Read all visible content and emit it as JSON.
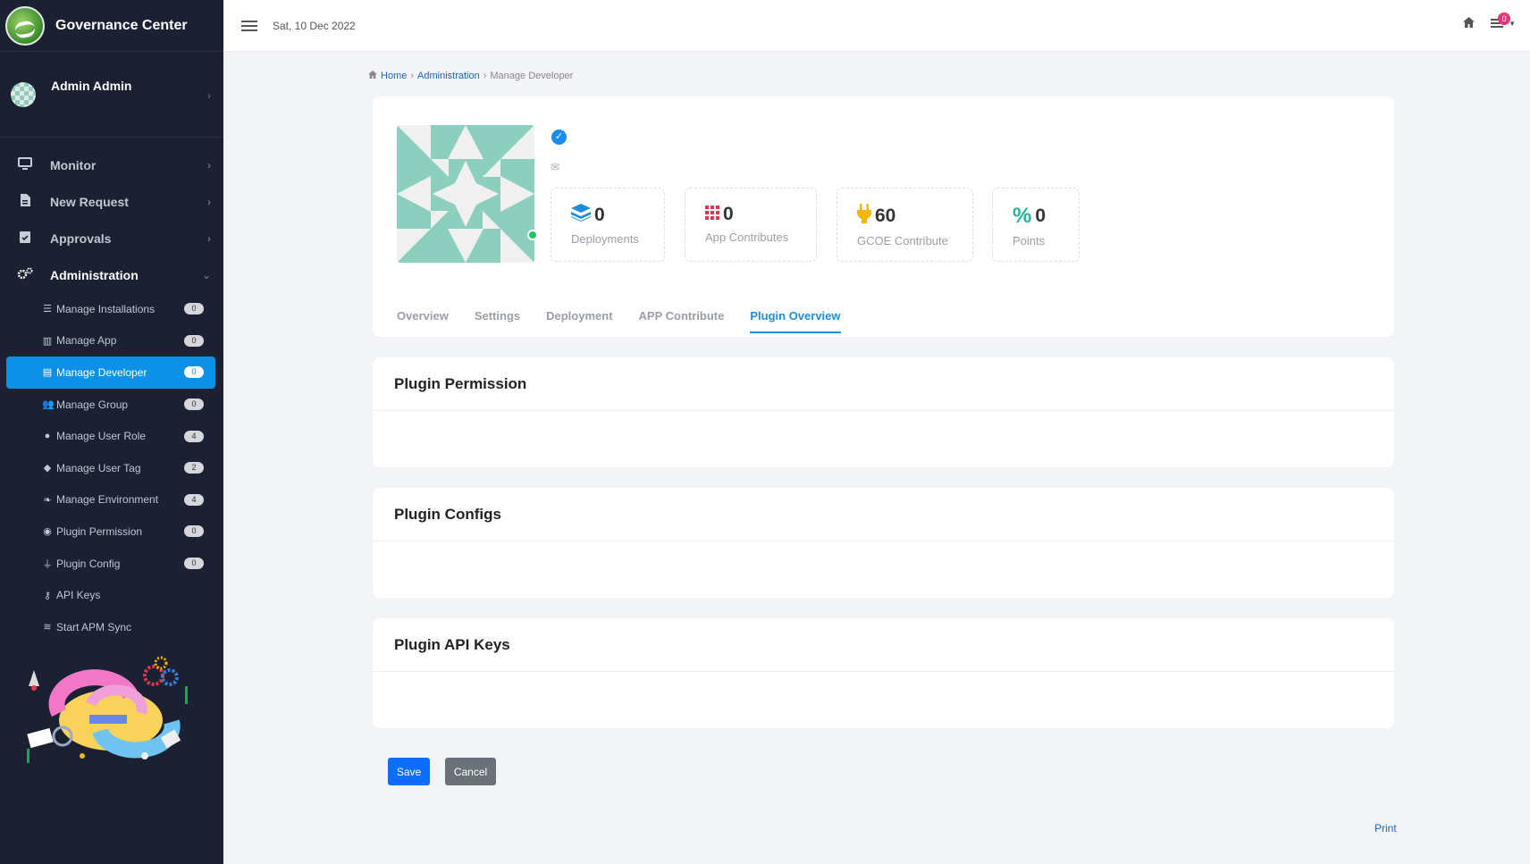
{
  "brand": {
    "name": "Governance Center"
  },
  "user": {
    "name": "Admin Admin"
  },
  "nav": {
    "items": [
      {
        "label": "Monitor",
        "icon": "monitor-icon"
      },
      {
        "label": "New Request",
        "icon": "file-icon"
      },
      {
        "label": "Approvals",
        "icon": "clipboard-check-icon"
      },
      {
        "label": "Administration",
        "icon": "cogs-icon"
      }
    ],
    "sub_items": [
      {
        "label": "Manage Installations",
        "badge": "0",
        "icon": "server-icon"
      },
      {
        "label": "Manage App",
        "badge": "0",
        "icon": "columns-icon"
      },
      {
        "label": "Manage Developer",
        "badge": "0",
        "icon": "id-card-icon"
      },
      {
        "label": "Manage Group",
        "badge": "0",
        "icon": "users-icon"
      },
      {
        "label": "Manage User Role",
        "badge": "4",
        "icon": "user-icon"
      },
      {
        "label": "Manage User Tag",
        "badge": "2",
        "icon": "tag-icon"
      },
      {
        "label": "Manage Environment",
        "badge": "4",
        "icon": "leaf-icon"
      },
      {
        "label": "Plugin Permission",
        "badge": "0",
        "icon": "eye-icon"
      },
      {
        "label": "Plugin Config",
        "badge": "0",
        "icon": "plug-icon"
      },
      {
        "label": "API Keys",
        "icon": "key-icon"
      },
      {
        "label": "Start APM Sync",
        "icon": "layers-icon"
      }
    ]
  },
  "topbar": {
    "date": "Sat, 10 Dec 2022",
    "notification_count": "0"
  },
  "breadcrumb": {
    "home": "Home",
    "admin": "Administration",
    "current": "Manage Developer"
  },
  "profile": {
    "stats": [
      {
        "value": "0",
        "label": "Deployments",
        "color": "#1d8fd9"
      },
      {
        "value": "0",
        "label": "App Contributes",
        "color": "#e8344e"
      },
      {
        "value": "60",
        "label": "GCOE Contribute",
        "color": "#f2b70a"
      },
      {
        "value": "0",
        "label": "Points",
        "color": "#1fb59a"
      }
    ],
    "tabs": [
      "Overview",
      "Settings",
      "Deployment",
      "APP Contribute",
      "Plugin Overview"
    ],
    "active_tab": "Plugin Overview"
  },
  "sections": {
    "permission": "Plugin Permission",
    "configs": "Plugin Configs",
    "api_keys": "Plugin API Keys"
  },
  "actions": {
    "save": "Save",
    "cancel": "Cancel",
    "print": "Print"
  },
  "colors": {
    "sidebar_bg": "#1b2032",
    "accent": "#0d91e6",
    "primary_button": "#0d6efd"
  }
}
